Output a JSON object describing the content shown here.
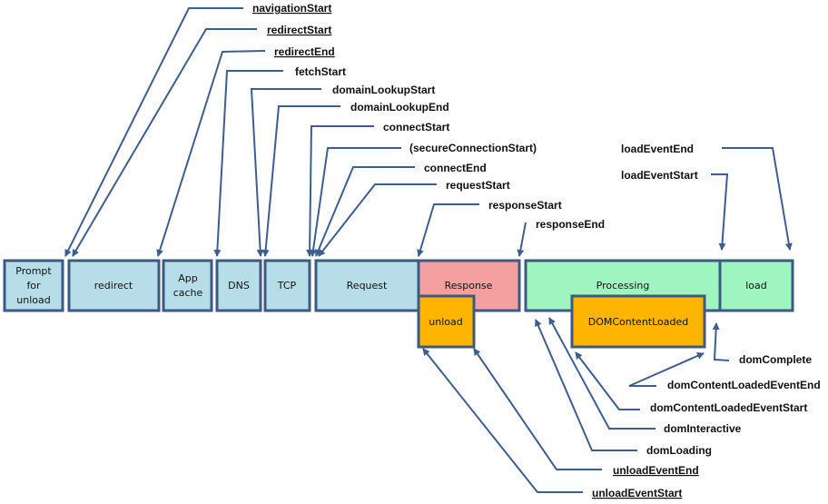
{
  "colors": {
    "line": "#3d5f8f",
    "border": "#3b5a85",
    "network_fill": "#b7dde8",
    "response_fill": "#f4a0a0",
    "processing_fill": "#9ef5c0",
    "event_fill": "#ffb400"
  },
  "boxes": {
    "prompt": [
      "Prompt",
      "for",
      "unload"
    ],
    "redirect": "redirect",
    "appcache": [
      "App",
      "cache"
    ],
    "dns": "DNS",
    "tcp": "TCP",
    "request": "Request",
    "response": "Response",
    "processing": "Processing",
    "load": "load",
    "unload": "unload",
    "domcontentloaded": "DOMContentLoaded"
  },
  "timestamps": {
    "navigationStart": "navigationStart",
    "redirectStart": "redirectStart",
    "redirectEnd": "redirectEnd",
    "fetchStart": "fetchStart",
    "domainLookupStart": "domainLookupStart",
    "domainLookupEnd": "domainLookupEnd",
    "connectStart": "connectStart",
    "secureConnectionStart": "(secureConnectionStart)",
    "connectEnd": "connectEnd",
    "requestStart": "requestStart",
    "responseStart": "responseStart",
    "responseEnd": "responseEnd",
    "loadEventEnd": "loadEventEnd",
    "loadEventStart": "loadEventStart",
    "domComplete": "domComplete",
    "domContentLoadedEventEnd": "domContentLoadedEventEnd",
    "domContentLoadedEventStart": "domContentLoadedEventStart",
    "domInteractive": "domInteractive",
    "domLoading": "domLoading",
    "unloadEventEnd": "unloadEventEnd",
    "unloadEventStart": "unloadEventStart"
  }
}
